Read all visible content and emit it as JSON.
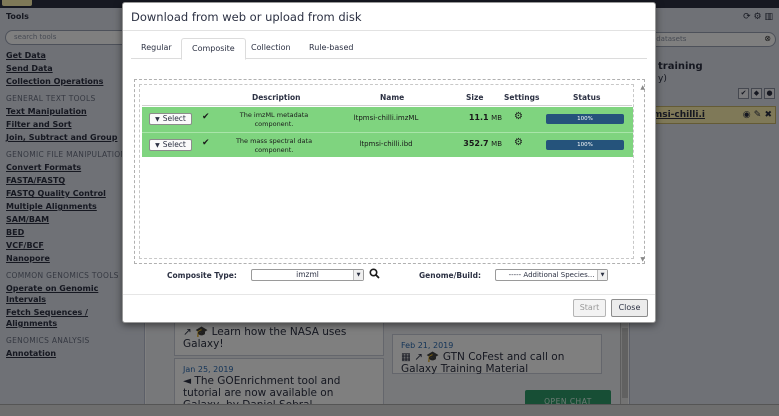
{
  "left_panel": {
    "title": "Tools",
    "search_placeholder": "search tools",
    "items": [
      {
        "type": "link",
        "label": "Get Data"
      },
      {
        "type": "link",
        "label": "Send Data"
      },
      {
        "type": "link",
        "label": "Collection Operations"
      },
      {
        "type": "section",
        "label": "GENERAL TEXT TOOLS"
      },
      {
        "type": "link",
        "label": "Text Manipulation"
      },
      {
        "type": "link",
        "label": "Filter and Sort"
      },
      {
        "type": "link",
        "label": "Join, Subtract and Group"
      },
      {
        "type": "section",
        "label": "GENOMIC FILE MANIPULATION"
      },
      {
        "type": "link",
        "label": "Convert Formats"
      },
      {
        "type": "link",
        "label": "FASTA/FASTQ"
      },
      {
        "type": "link",
        "label": "FASTQ Quality Control"
      },
      {
        "type": "link",
        "label": "Multiple Alignments"
      },
      {
        "type": "link",
        "label": "SAM/BAM"
      },
      {
        "type": "link",
        "label": "BED"
      },
      {
        "type": "link",
        "label": "VCF/BCF"
      },
      {
        "type": "link",
        "label": "Nanopore"
      },
      {
        "type": "section",
        "label": "COMMON GENOMICS TOOLS"
      },
      {
        "type": "link",
        "label": "Operate on Genomic Intervals"
      },
      {
        "type": "link",
        "label": "Fetch Sequences / Alignments"
      },
      {
        "type": "section",
        "label": "GENOMICS ANALYSIS"
      },
      {
        "type": "link",
        "label": "Annotation"
      }
    ]
  },
  "right_panel": {
    "title": "ry",
    "search_placeholder": "rch datasets",
    "history_name": "training",
    "history_sub": "y)",
    "history_item": "ltpmsi-chilli.i"
  },
  "center": {
    "news": [
      {
        "date": "",
        "title": "Learn how the NASA uses Galaxy!"
      },
      {
        "date": "Feb 21, 2019",
        "title": "GTN CoFest and call on Galaxy Training Material"
      },
      {
        "date": "Jan 25, 2019",
        "title": "The GOEnrichment tool and tutorial are now available on Galaxy, by Daniel Sobral"
      }
    ],
    "chat_label": "OPEN CHAT"
  },
  "modal": {
    "title": "Download from web or upload from disk",
    "tabs": [
      "Regular",
      "Composite",
      "Collection",
      "Rule-based"
    ],
    "active_tab": "Composite",
    "columns": {
      "description": "Description",
      "name": "Name",
      "size": "Size",
      "settings": "Settings",
      "status": "Status"
    },
    "rows": [
      {
        "select_label": "Select",
        "description": "The imzML metadata component.",
        "name": "ltpmsi-chilli.imzML",
        "size_value": "11.1",
        "size_unit": "MB",
        "progress_label": "100%",
        "progress": 100
      },
      {
        "select_label": "Select",
        "description": "The mass spectral data component.",
        "name": "ltpmsi-chilli.ibd",
        "size_value": "352.7",
        "size_unit": "MB",
        "progress_label": "100%",
        "progress": 100
      }
    ],
    "composite_type_label": "Composite Type:",
    "composite_type_value": "imzml",
    "genome_label": "Genome/Build:",
    "genome_value": "----- Additional Species...",
    "start_label": "Start",
    "close_label": "Close"
  },
  "colors": {
    "row_complete": "#7fd47f",
    "progress_fill": "#25537b",
    "masthead": "#2c3143",
    "history_item_bg": "#fff3b0",
    "chat_button": "#2e9c6a"
  }
}
